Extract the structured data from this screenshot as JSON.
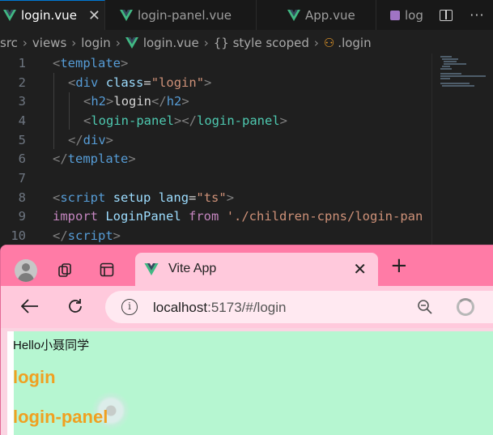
{
  "editor": {
    "tabs": [
      {
        "label": "login.vue",
        "close": "✕"
      },
      {
        "label": "login-panel.vue"
      },
      {
        "label": "App.vue"
      },
      {
        "label": "log"
      }
    ],
    "breadcrumb": [
      "src",
      "views",
      "login",
      "login.vue",
      "{} style scoped",
      ".login"
    ],
    "lines": [
      {
        "n": "1"
      },
      {
        "n": "2"
      },
      {
        "n": "3"
      },
      {
        "n": "4"
      },
      {
        "n": "5"
      },
      {
        "n": "6"
      },
      {
        "n": "7"
      },
      {
        "n": "8"
      },
      {
        "n": "9"
      },
      {
        "n": "10"
      }
    ],
    "code": {
      "l1": [
        "<",
        "template",
        ">"
      ],
      "l2": [
        "<",
        "div",
        " ",
        "class",
        "=",
        "\"login\"",
        ">"
      ],
      "l3": [
        "<",
        "h2",
        ">",
        "login",
        "</",
        "h2",
        ">"
      ],
      "l4": [
        "<",
        "login-panel",
        "></",
        "login-panel",
        ">"
      ],
      "l5": [
        "</",
        "div",
        ">"
      ],
      "l6": [
        "</",
        "template",
        ">"
      ],
      "l8": [
        "<",
        "script",
        " ",
        "setup",
        " ",
        "lang",
        "=",
        "\"ts\"",
        ">"
      ],
      "l9": [
        "import",
        " ",
        "LoginPanel",
        " ",
        "from",
        " ",
        "'./children-cpns/login-pan"
      ],
      "l10": [
        "</",
        "script",
        ">"
      ]
    }
  },
  "browser": {
    "tab_title": "Vite App",
    "close": "✕",
    "new_tab": "+",
    "url_host": "localhost",
    "url_rest": ":5173/#/login",
    "page": {
      "hello": "Hello小聂同学",
      "h_login": "login",
      "h_panel": "login-panel"
    }
  },
  "colors": {
    "vue_green": "#41b883",
    "browser_tab_strip": "#ff7ba6",
    "page_bg": "#b6f6d1",
    "heading": "#f0a020"
  }
}
